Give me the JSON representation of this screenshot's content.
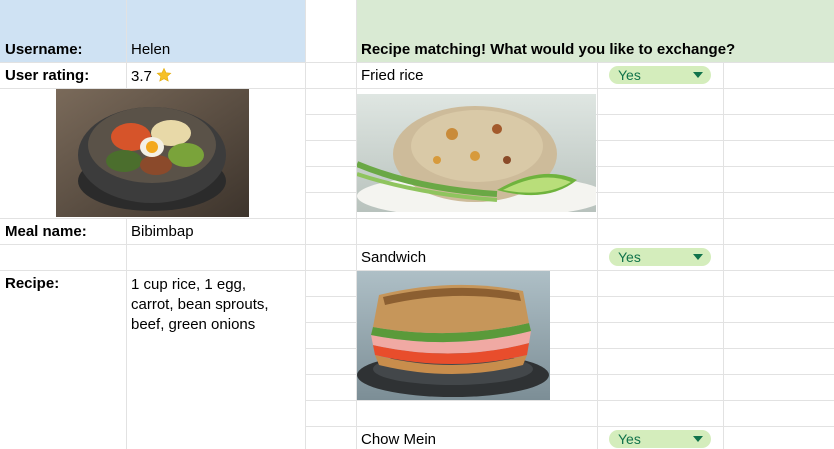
{
  "profile": {
    "username_label": "Username:",
    "username_value": "Helen",
    "rating_label": "User rating:",
    "rating_value": "3.7",
    "rating_icon": "star-icon",
    "meal_label": "Meal name:",
    "meal_value": "Bibimbap",
    "recipe_label": "Recipe:",
    "recipe_lines": [
      "1 cup rice, 1 egg,",
      "carrot, bean sprouts,",
      "beef, green onions"
    ]
  },
  "matching": {
    "header": "Recipe matching! What would you like to exchange?",
    "items": [
      {
        "name": "Fried rice",
        "choice": "Yes"
      },
      {
        "name": "Sandwich",
        "choice": "Yes"
      },
      {
        "name": "Chow Mein",
        "choice": "Yes"
      }
    ]
  },
  "colors": {
    "profile_header_bg": "#cfe2f3",
    "matching_header_bg": "#d9ead3",
    "chip_bg": "#d4edbc",
    "chip_text": "#11734b",
    "star": "#f6c026"
  }
}
